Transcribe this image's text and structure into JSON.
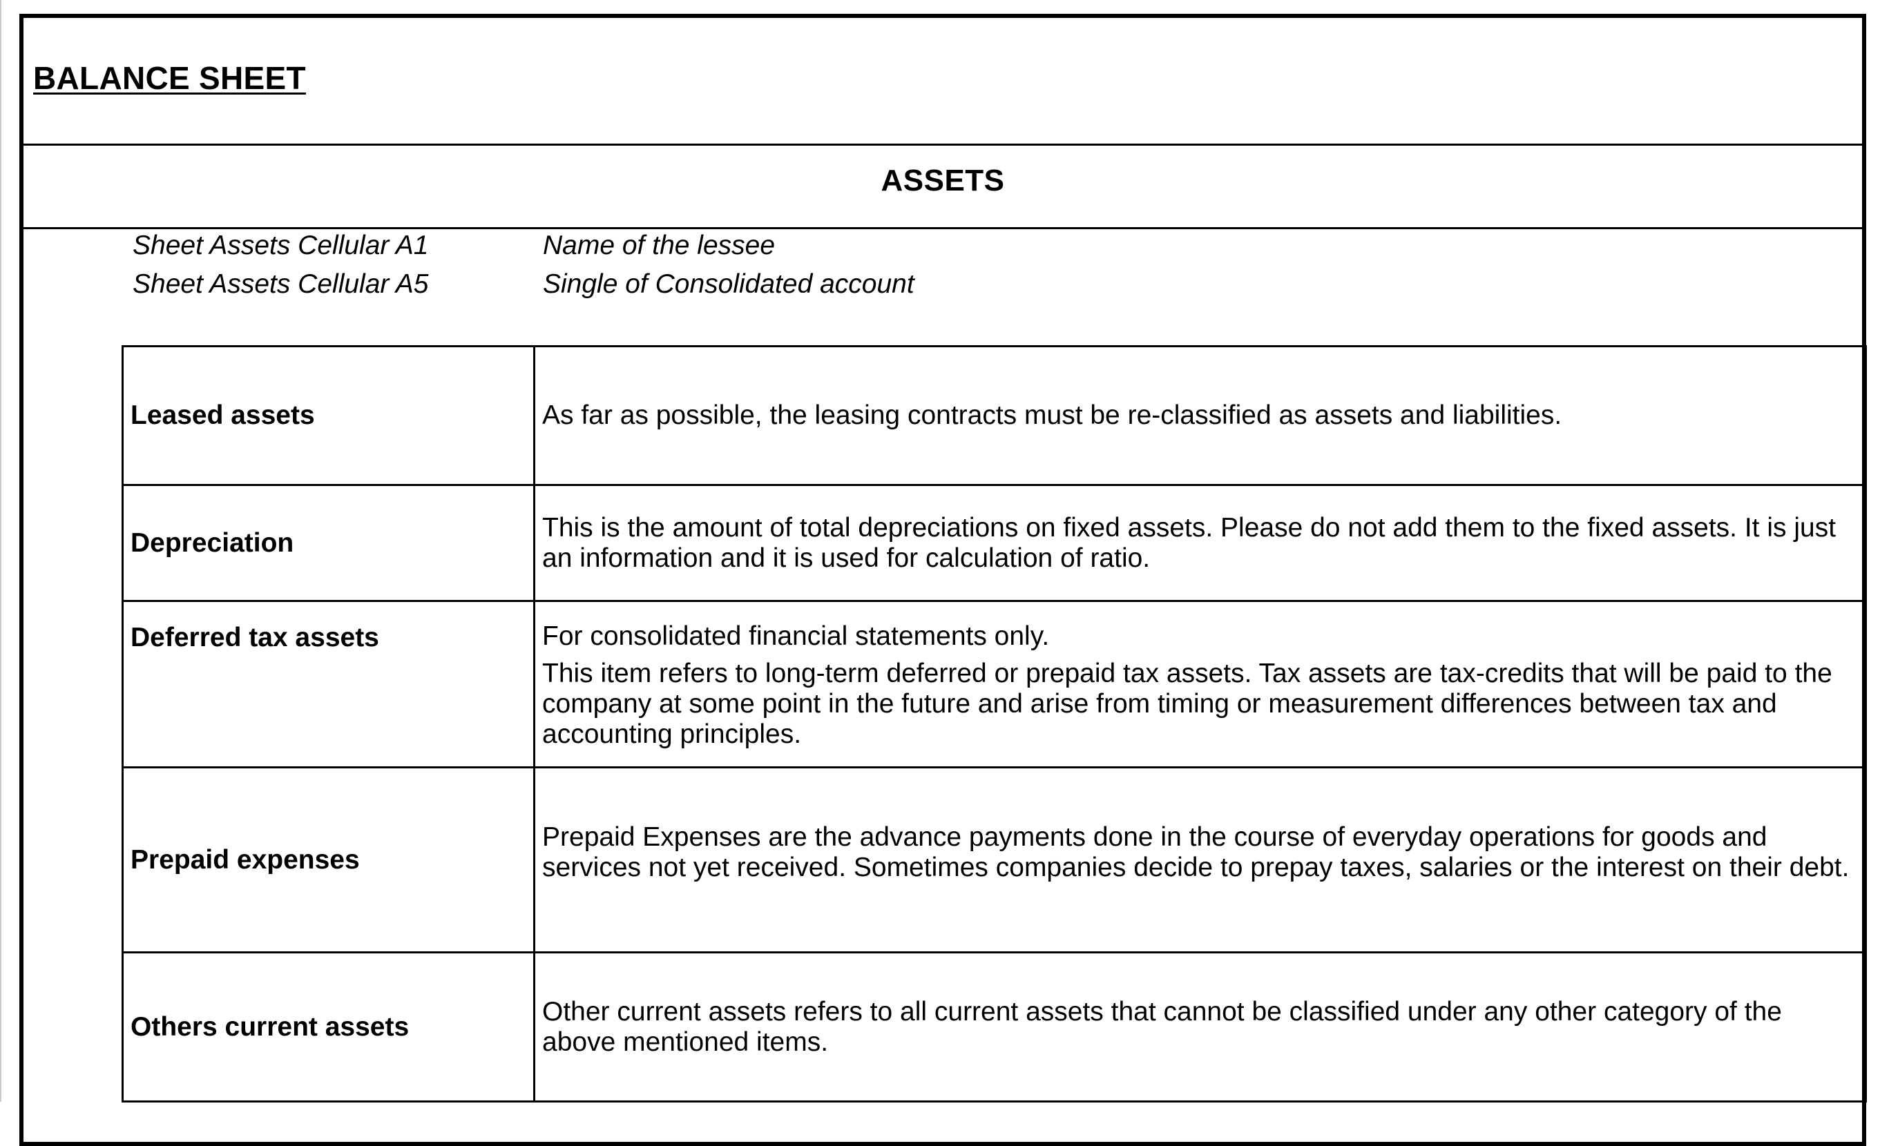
{
  "document": {
    "title": "BALANCE SHEET",
    "section": "ASSETS"
  },
  "info": [
    {
      "label": "Sheet Assets Cellular A1",
      "value": "Name of the lessee"
    },
    {
      "label": "Sheet Assets Cellular A5",
      "value": "Single of Consolidated account"
    }
  ],
  "definitions": [
    {
      "term": "Leased assets",
      "description": [
        "As far as possible, the leasing contracts must be re-classified as assets and liabilities."
      ]
    },
    {
      "term": "Depreciation",
      "description": [
        "This is the amount of total depreciations on fixed assets. Please do not add them to the fixed assets. It is just an information and it is used for calculation of ratio."
      ]
    },
    {
      "term": "Deferred tax assets",
      "description": [
        "For consolidated financial statements only.",
        "This item refers to long-term deferred or prepaid tax assets. Tax assets are tax-credits that will be paid to the company at some point in the future and arise from timing or measurement differences between tax and accounting principles."
      ]
    },
    {
      "term": "Prepaid expenses",
      "description": [
        "Prepaid Expenses are the advance payments done in the course of everyday operations for goods and services not yet received. Sometimes companies decide to prepay taxes, salaries or the interest on their debt."
      ]
    },
    {
      "term": "Others current assets",
      "description": [
        "Other current assets refers to all current assets that cannot be classified under any other category of the above mentioned items."
      ]
    }
  ]
}
